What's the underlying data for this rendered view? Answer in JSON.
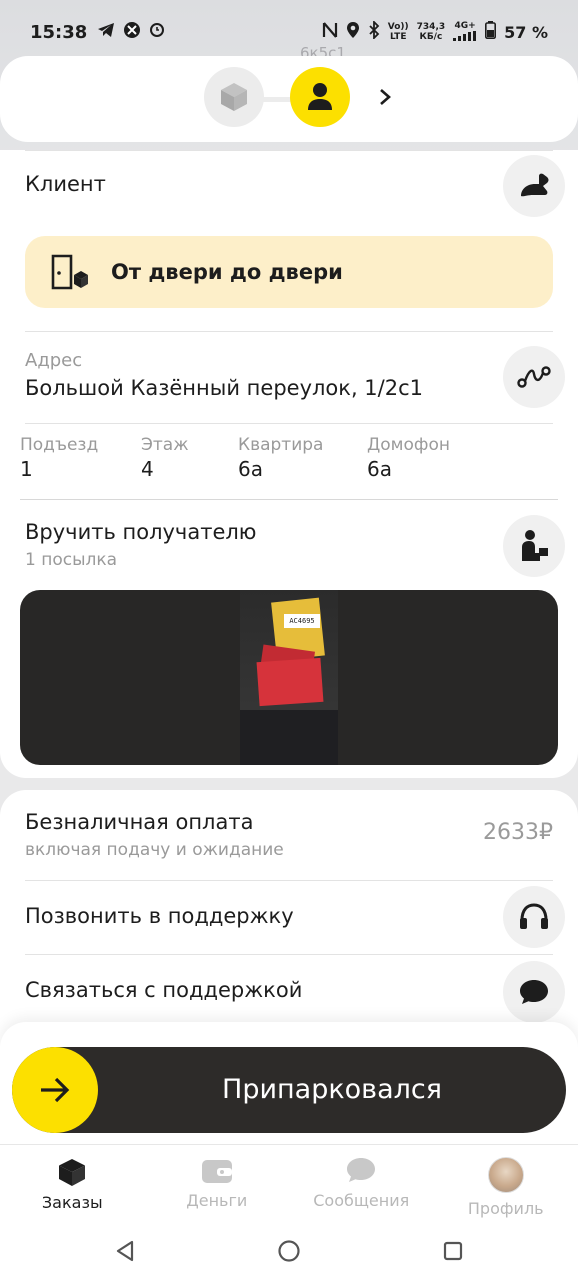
{
  "status_bar": {
    "time": "15:38",
    "net_speed_top": "734,3",
    "net_speed_bottom": "КБ/с",
    "net_type_top": "4G+",
    "volte_top": "Vo))",
    "volte_bottom": "LTE",
    "battery": "57 %"
  },
  "map": {
    "street_fragment": "6к5с1"
  },
  "client_section": {
    "title": "Клиент",
    "banner_text": "От двери до двери"
  },
  "address": {
    "label": "Адрес",
    "value": "Большой Казённый переулок, 1/2с1"
  },
  "details": [
    {
      "label": "Подъезд",
      "value": "1"
    },
    {
      "label": "Этаж",
      "value": "4"
    },
    {
      "label": "Квартира",
      "value": "6а"
    },
    {
      "label": "Домофон",
      "value": "6а"
    }
  ],
  "handover": {
    "title": "Вручить получателю",
    "subtitle": "1 посылка",
    "parcel_tag": "AC4695"
  },
  "payment": {
    "title": "Безналичная оплата",
    "subtitle": "включая подачу и ожидание",
    "price": "2633₽"
  },
  "support": {
    "call_label": "Позвонить в поддержку",
    "chat_label": "Связаться с поддержкой"
  },
  "slider": {
    "label": "Припарковался"
  },
  "tabs": [
    {
      "label": "Заказы",
      "active": true
    },
    {
      "label": "Деньги",
      "active": false
    },
    {
      "label": "Сообщения",
      "active": false
    },
    {
      "label": "Профиль",
      "active": false
    }
  ],
  "colors": {
    "accent": "#fce000",
    "banner_bg": "#fdefc9",
    "slider_bg": "#2d2b29"
  }
}
